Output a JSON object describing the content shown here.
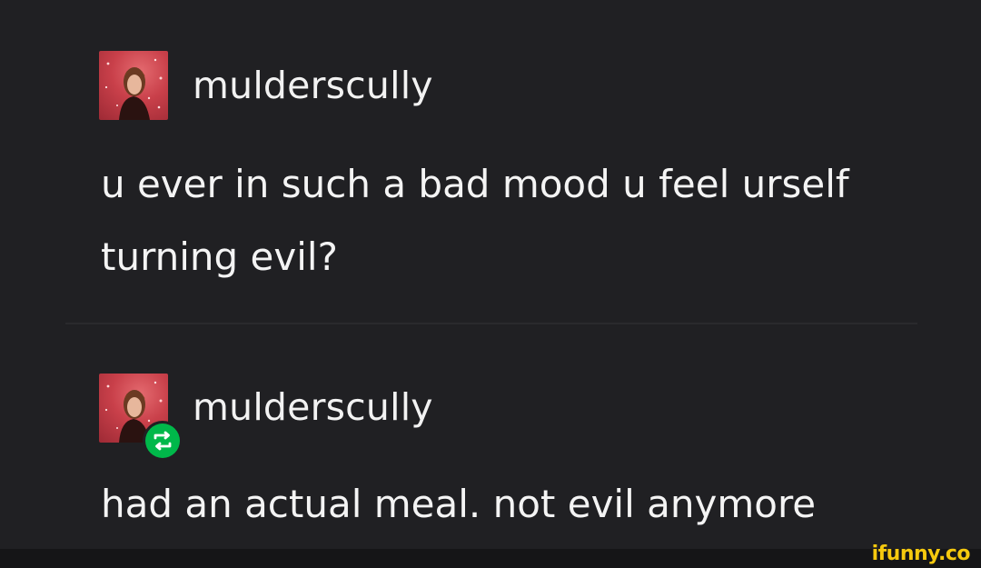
{
  "posts": [
    {
      "username": "mulderscully",
      "lines": [
        "u ever in such a bad mood u feel urself",
        "turning evil?"
      ]
    },
    {
      "username": "mulderscully",
      "lines": [
        "had an actual meal. not evil anymore"
      ],
      "reblog_icon": "reblog-icon"
    }
  ],
  "colors": {
    "background": "#202023",
    "text": "#f2f2f2",
    "reblog_badge": "#00b84a",
    "watermark": "#f6c90e"
  },
  "watermark": "ifunny.co"
}
